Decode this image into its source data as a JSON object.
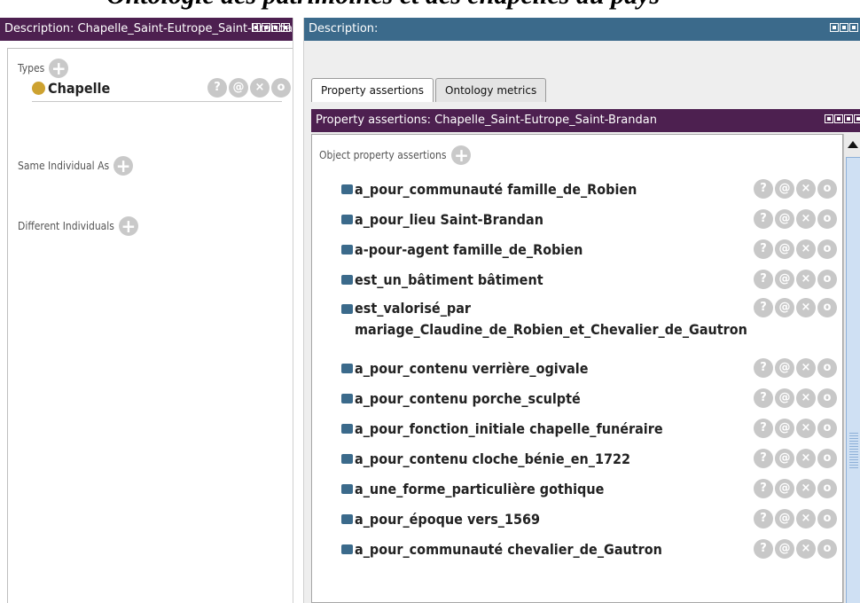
{
  "caption_cut": "Ontologie des patrimoines et des chapelles du pays",
  "left": {
    "title": "Description: Chapelle_Saint-Eutrope_Saint-Brandan",
    "types_label": "Types",
    "type_value": "Chapelle",
    "same_label": "Same Individual As",
    "different_label": "Different Individuals",
    "add_symbol": "+",
    "action_symbols": [
      "?",
      "@",
      "×",
      "o"
    ]
  },
  "right": {
    "title": "Description:",
    "tabs": [
      "Property assertions",
      "Ontology metrics"
    ],
    "inner_title": "Property assertions: Chapelle_Saint-Eutrope_Saint-Brandan",
    "section_label": "Object property assertions",
    "rows": [
      "a_pour_communauté  famille_de_Robien",
      "a_pour_lieu  Saint-Brandan",
      "a-pour-agent  famille_de_Robien",
      "est_un_bâtiment  bâtiment",
      "est_valorisé_par  mariage_Claudine_de_Robien_et_Chevalier_de_Gautron",
      "a_pour_contenu  verrière_ogivale",
      "a_pour_contenu  porche_sculpté",
      "a_pour_fonction_initiale  chapelle_funéraire",
      "a_pour_contenu  cloche_bénie_en_1722",
      "a_une_forme_particulière  gothique",
      "a_pour_époque  vers_1569",
      "a_pour_communauté  chevalier_de_Gautron"
    ]
  },
  "colors": {
    "title_purple": "#4d2050",
    "title_teal": "#3b6a8b",
    "type_dot": "#cda230",
    "action_grey": "#c8c8c8"
  }
}
